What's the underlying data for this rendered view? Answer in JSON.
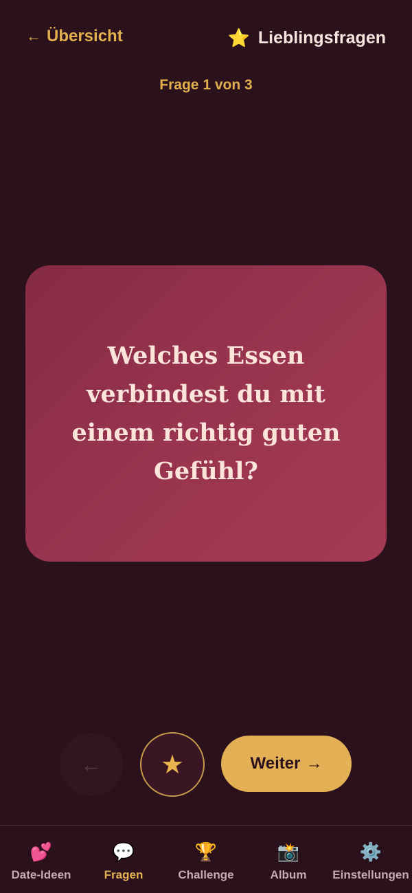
{
  "header": {
    "back_label": "Übersicht",
    "title": "Lieblingsfragen"
  },
  "counter": "Frage 1 von 3",
  "card": {
    "question": "Welches Essen verbindest du mit einem richtig guten Gefühl?"
  },
  "actions": {
    "next_label": "Weiter"
  },
  "tabs": [
    {
      "label": "Date-Ideen",
      "icon": "hearts-icon",
      "active": false
    },
    {
      "label": "Fragen",
      "icon": "speech-bubble-icon",
      "active": true
    },
    {
      "label": "Challenge",
      "icon": "trophy-icon",
      "active": false
    },
    {
      "label": "Album",
      "icon": "camera-icon",
      "active": false
    },
    {
      "label": "Einstellungen",
      "icon": "gear-icon",
      "active": false
    }
  ],
  "colors": {
    "background": "#2a111c",
    "accent": "#e2b04e",
    "card": "#9a3550"
  }
}
